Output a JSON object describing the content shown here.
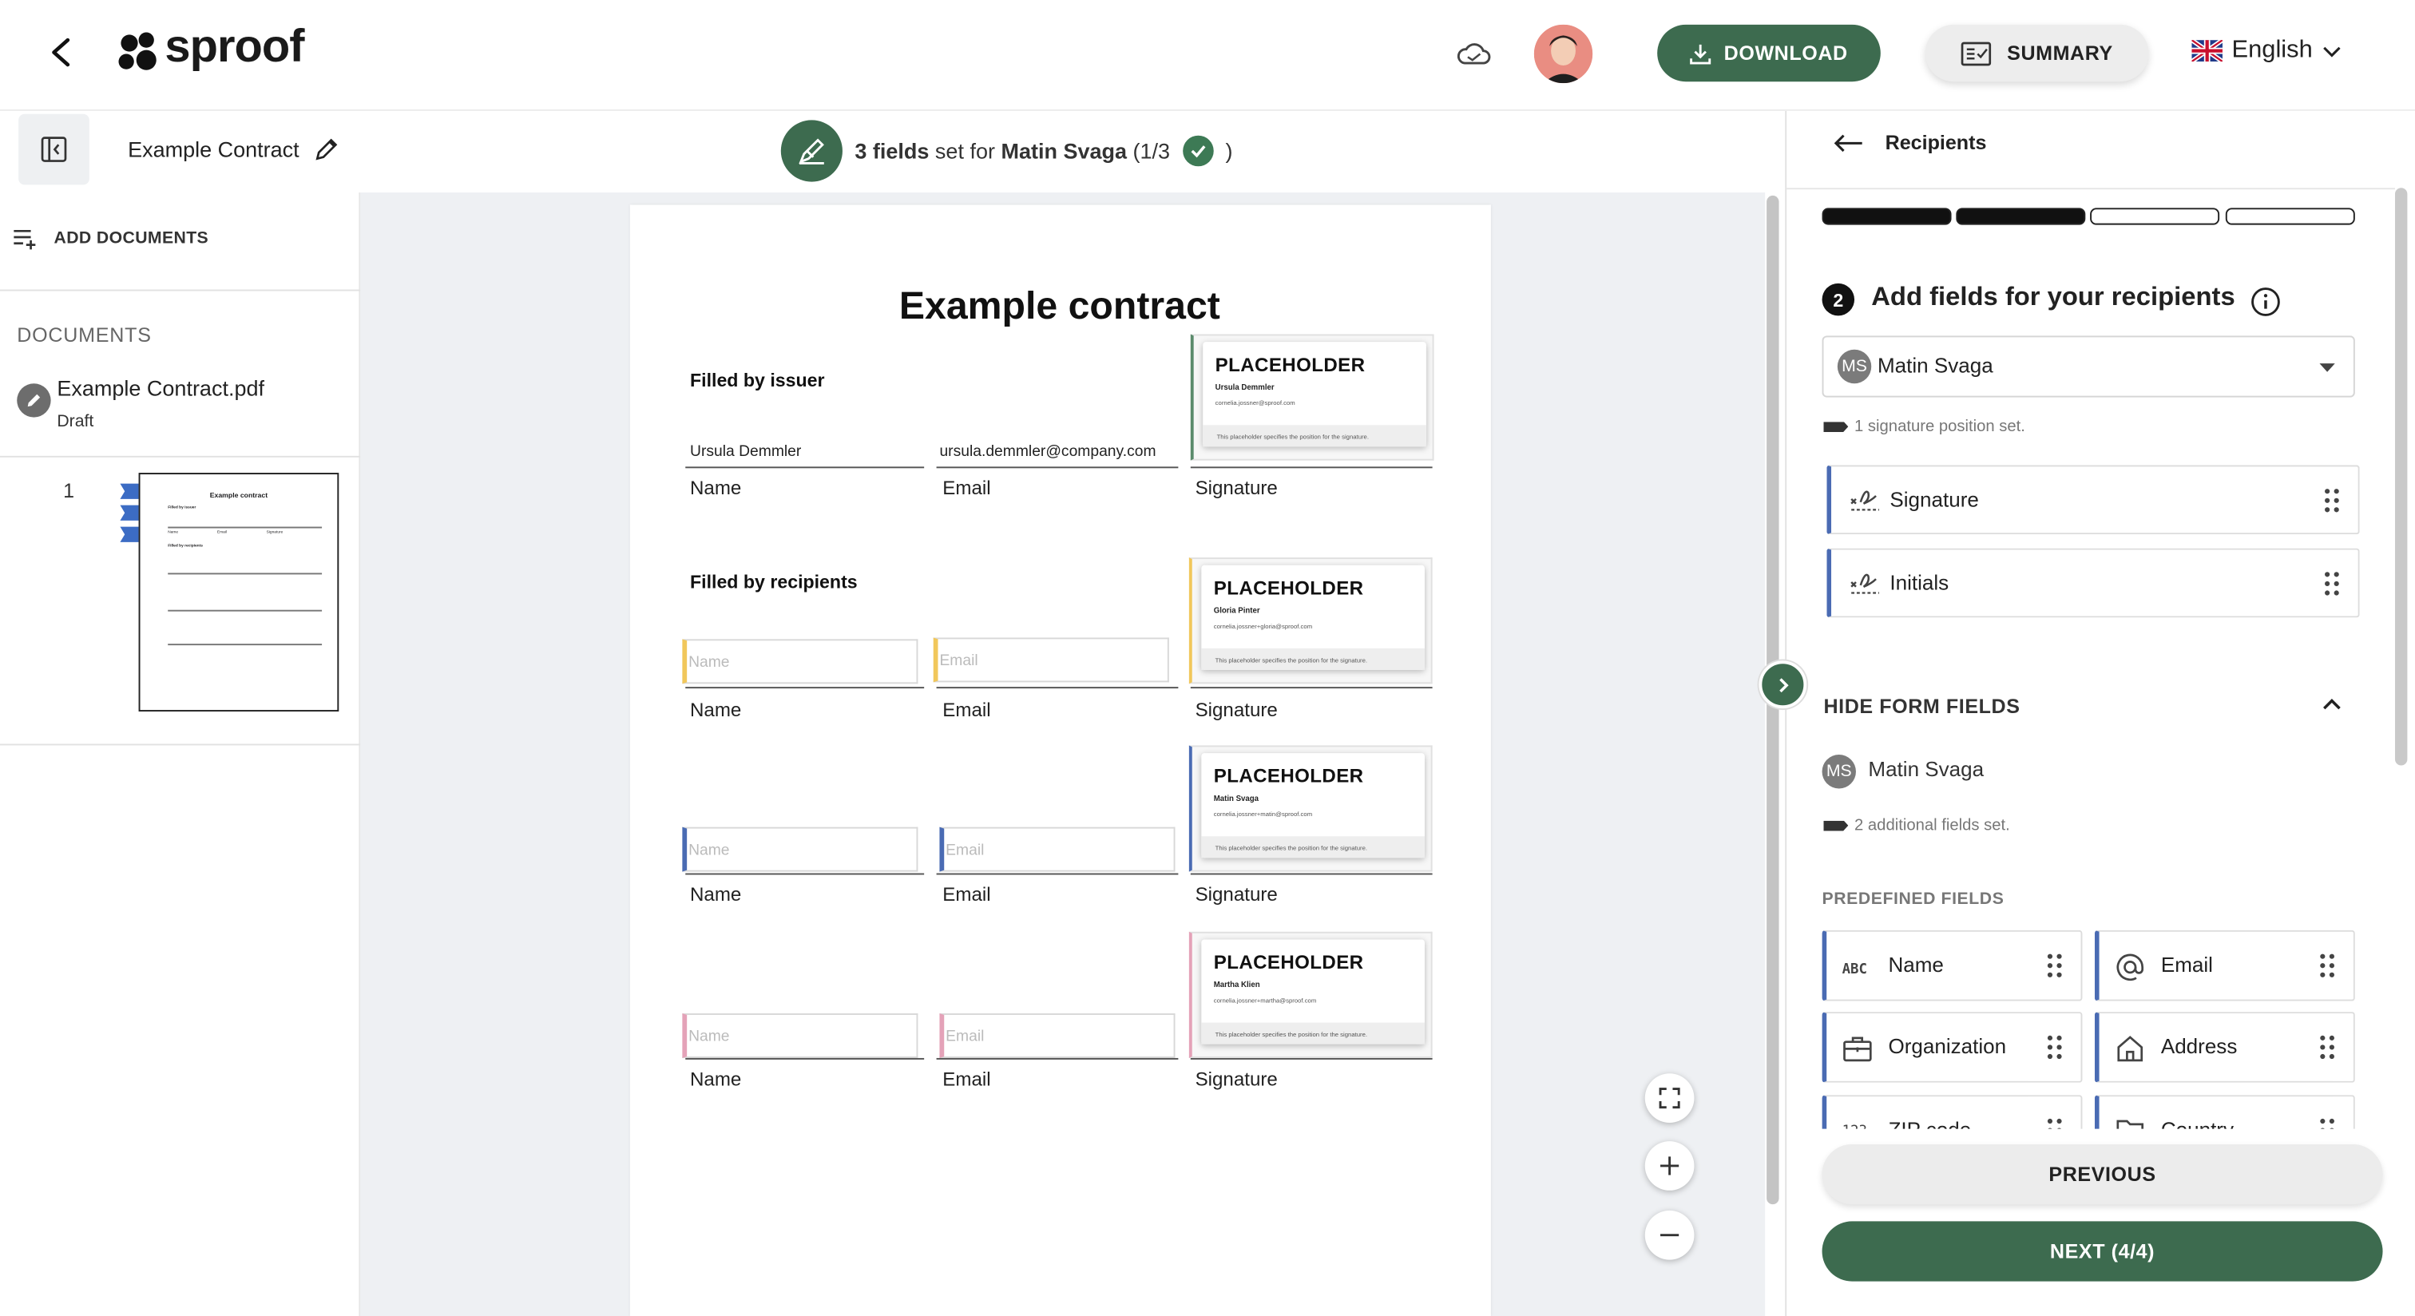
{
  "header": {
    "logo_text": "sproof",
    "download_label": "DOWNLOAD",
    "summary_label": "SUMMARY",
    "language": "English"
  },
  "toolbar": {
    "document_title": "Example Contract",
    "fields_count": "3 fields",
    "fields_set_for": "set for",
    "recipient_name": "Matin Svaga",
    "progress_open": "(1/3",
    "progress_close": ")"
  },
  "sidebar": {
    "add_documents_label": "ADD DOCUMENTS",
    "documents_heading": "DOCUMENTS",
    "document": {
      "name": "Example Contract.pdf",
      "status": "Draft"
    },
    "page_number": "1",
    "thumbnail": {
      "title": "Example contract",
      "issuer_label": "Filled by issuer",
      "recipients_label": "Filled by recipients",
      "col_name": "Name",
      "col_email": "Email",
      "col_signature": "Signature"
    }
  },
  "document": {
    "title": "Example contract",
    "issuer_section": "Filled by issuer",
    "recipients_section": "Filled by recipients",
    "issuer": {
      "name_value": "Ursula Demmler",
      "email_value": "ursula.demmler@company.com"
    },
    "labels": {
      "name": "Name",
      "email": "Email",
      "signature": "Signature"
    },
    "input_placeholders": {
      "name": "Name",
      "email": "Email"
    },
    "placeholders": [
      {
        "title": "PLACEHOLDER",
        "name": "Ursula Demmler",
        "email": "cornelia.jossner@sproof.com",
        "note": "This placeholder specifies the position for the signature.",
        "color": "#5a8a6b"
      },
      {
        "title": "PLACEHOLDER",
        "name": "Gloria Pinter",
        "email": "cornelia.jossner+gloria@sproof.com",
        "note": "This placeholder specifies the position for the signature.",
        "color": "#f1c75b"
      },
      {
        "title": "PLACEHOLDER",
        "name": "Matin Svaga",
        "email": "cornelia.jossner+matin@sproof.com",
        "note": "This placeholder specifies the position for the signature.",
        "color": "#4a6bb3"
      },
      {
        "title": "PLACEHOLDER",
        "name": "Martha Klien",
        "email": "cornelia.jossner+martha@sproof.com",
        "note": "This placeholder specifies the position for the signature.",
        "color": "#e4a2b8"
      }
    ]
  },
  "right_panel": {
    "back_label": "Recipients",
    "step_number": "2",
    "step_title": "Add fields for your recipients",
    "selected_recipient_initials": "MS",
    "selected_recipient": "Matin Svaga",
    "signature_note": "1 signature position set.",
    "signature_fields": [
      {
        "label": "Signature"
      },
      {
        "label": "Initials"
      }
    ],
    "hide_form_fields_label": "HIDE FORM FIELDS",
    "form_recipient": "Matin Svaga",
    "additional_note": "2 additional fields set.",
    "predefined_label": "PREDEFINED FIELDS",
    "predefined_fields": [
      {
        "label": "Name",
        "icon": "abc-icon"
      },
      {
        "label": "Email",
        "icon": "at-icon"
      },
      {
        "label": "Organization",
        "icon": "briefcase-icon"
      },
      {
        "label": "Address",
        "icon": "home-icon"
      },
      {
        "label": "ZIP code",
        "icon": "number-icon"
      },
      {
        "label": "Country",
        "icon": "folder-icon"
      }
    ],
    "previous_label": "PREVIOUS",
    "next_label": "NEXT (4/4)"
  },
  "colors": {
    "brand_green": "#3d6b4f",
    "accent_blue": "#4a6bb3"
  }
}
